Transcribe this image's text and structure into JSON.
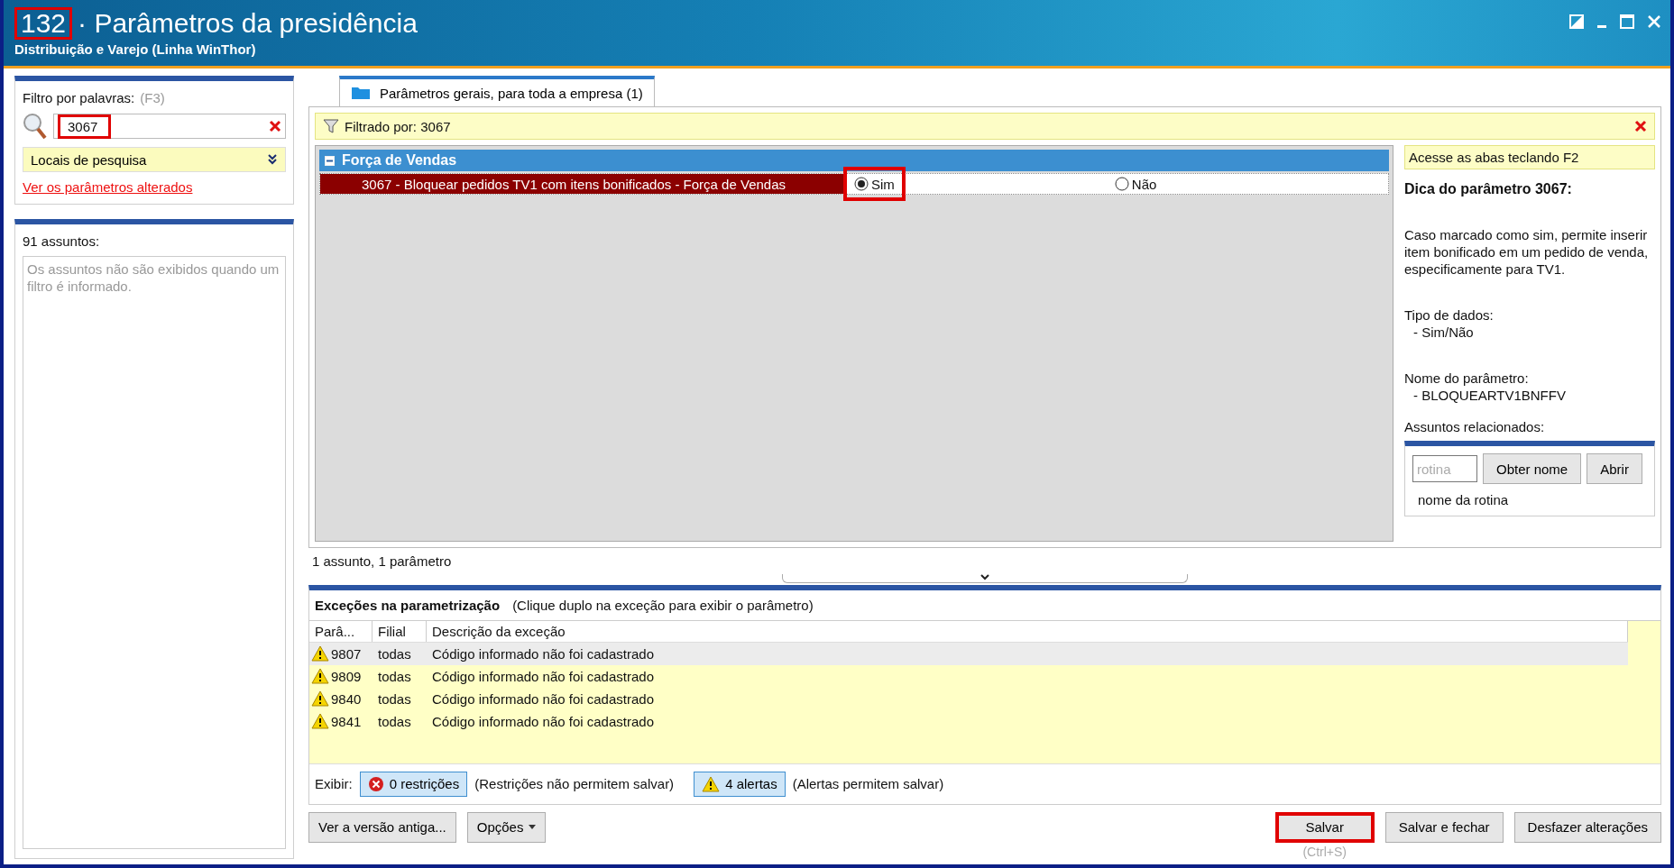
{
  "window": {
    "number": "132",
    "number_highlighted": true,
    "title": "· Parâmetros da presidência",
    "subtitle": "Distribuição e Varejo (Linha WinThor)"
  },
  "filter": {
    "label": "Filtro por palavras:",
    "shortcut": "(F3)",
    "value": "3067",
    "highlighted": true,
    "locations": "Locais de pesquisa",
    "changed_link": "Ver os parâmetros alterados"
  },
  "subjects": {
    "count_label": "91 assuntos:",
    "empty_message": "Os assuntos não são exibidos quando um filtro é informado."
  },
  "tabs": [
    {
      "label": "Parâmetros gerais, para toda a empresa  (1)",
      "selected": true
    }
  ],
  "filter_bar": {
    "text": "Filtrado por: 3067"
  },
  "groups": [
    {
      "title": "Força de Vendas",
      "expanded": true,
      "parameters": [
        {
          "label": "3067 - Bloquear pedidos TV1 com itens bonificados - Força de Vendas",
          "selected": true,
          "options": [
            {
              "label": "Sim",
              "selected": true,
              "highlighted": true
            },
            {
              "label": "Não",
              "selected": false,
              "highlighted": false
            }
          ]
        }
      ]
    }
  ],
  "grid_status": "1 assunto, 1 parâmetro",
  "tip_panel": {
    "hint": "Acesse as abas teclando F2",
    "title": "Dica do parâmetro 3067:",
    "description": "Caso marcado como sim, permite inserir item bonificado em um pedido de venda, especificamente para TV1.",
    "data_type_label": "Tipo de dados:",
    "data_type": "- Sim/Não",
    "name_label": "Nome do parâmetro:",
    "name": "- BLOQUEARTV1BNFFV",
    "related_label": "Assuntos relacionados:",
    "routine_placeholder": "rotina",
    "buttons": [
      "Obter nome",
      "Abrir"
    ],
    "routine_name": "nome da rotina"
  },
  "exceptions": {
    "title": "Exceções na parametrização",
    "hint": "(Clique duplo na exceção para exibir o parâmetro)",
    "columns": [
      "Parâ...",
      "Filial",
      "Descrição da exceção"
    ],
    "rows": [
      {
        "param": "9807",
        "branch": "todas",
        "description": "Código informado não foi cadastrado",
        "selected": true
      },
      {
        "param": "9809",
        "branch": "todas",
        "description": "Código informado não foi cadastrado",
        "selected": false
      },
      {
        "param": "9840",
        "branch": "todas",
        "description": "Código informado não foi cadastrado",
        "selected": false
      },
      {
        "param": "9841",
        "branch": "todas",
        "description": "Código informado não foi cadastrado",
        "selected": false
      }
    ],
    "show_label": "Exibir:",
    "toggles": [
      {
        "kind": "error",
        "label": "0 restrições",
        "note": "(Restrições não permitem salvar)",
        "on": true
      },
      {
        "kind": "warning",
        "label": "4 alertas",
        "note": "(Alertas permitem salvar)",
        "on": true
      }
    ]
  },
  "buttons_left": [
    {
      "kind": "plain",
      "label": "Ver a versão antiga..."
    },
    {
      "kind": "menu",
      "label": "Opções"
    }
  ],
  "buttons_right": [
    {
      "label": "Salvar",
      "hint": "(Ctrl+S)",
      "highlighted": true
    },
    {
      "label": "Salvar e fechar",
      "highlighted": false
    },
    {
      "label": "Desfazer alterações",
      "highlighted": false
    }
  ]
}
